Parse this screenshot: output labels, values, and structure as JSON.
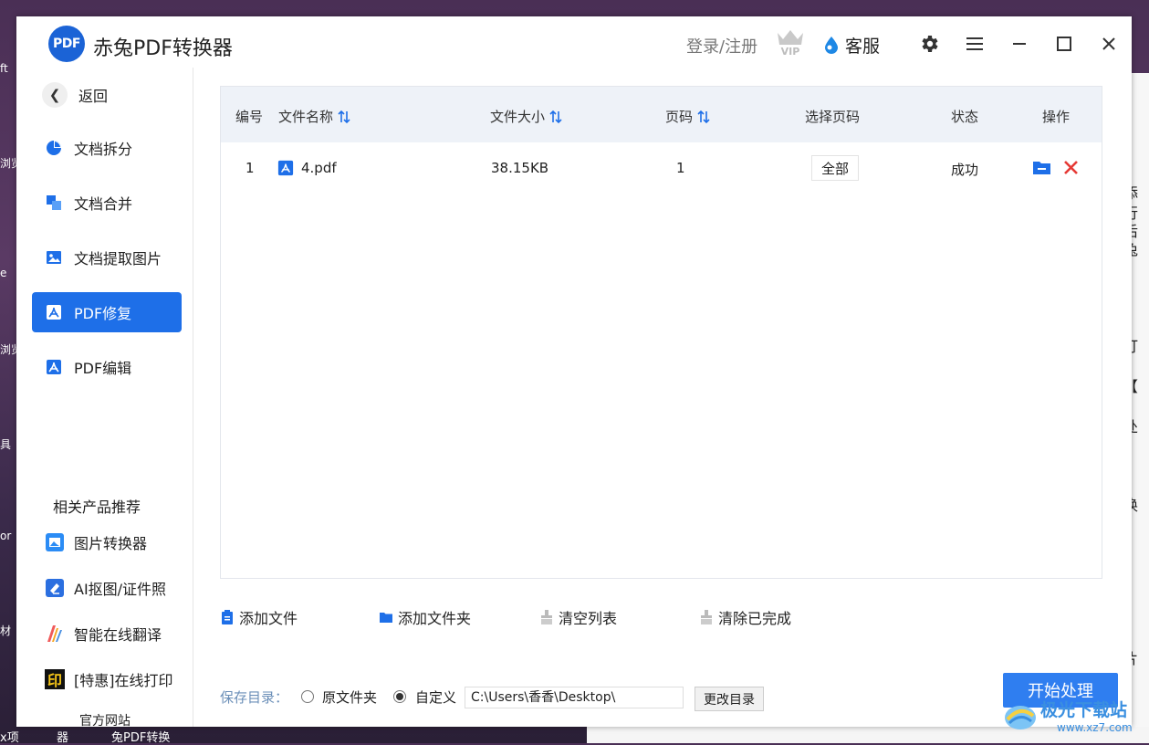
{
  "app": {
    "logo_text": "PDF",
    "title": "赤兔PDF转换器"
  },
  "header": {
    "login": "登录/注册",
    "service": "客服",
    "vip_text": "VIP"
  },
  "sidebar": {
    "back": "返回",
    "items": [
      {
        "label": "文档拆分"
      },
      {
        "label": "文档合并"
      },
      {
        "label": "文档提取图片"
      },
      {
        "label": "PDF修复"
      },
      {
        "label": "PDF编辑"
      }
    ],
    "active_index": 3,
    "recommend_title": "相关产品推荐",
    "recommend": [
      {
        "label": "图片转换器"
      },
      {
        "label": "AI抠图/证件照"
      },
      {
        "label": "智能在线翻译"
      },
      {
        "label": "[特惠]在线打印",
        "icon_text": "印"
      }
    ],
    "official_site": "官方网站"
  },
  "table": {
    "headers": [
      "编号",
      "文件名称",
      "文件大小",
      "页码",
      "选择页码",
      "状态",
      "操作"
    ],
    "rows": [
      {
        "index": "1",
        "name": "4.pdf",
        "size": "38.15KB",
        "pages": "1",
        "page_select": "全部",
        "status": "成功"
      }
    ]
  },
  "actions": {
    "add_file": "添加文件",
    "add_folder": "添加文件夹",
    "clear_list": "清空列表",
    "clear_done": "清除已完成"
  },
  "save": {
    "label": "保存目录：",
    "option_original": "原文件夹",
    "option_custom": "自定义",
    "selected": "自定义",
    "path": "C:\\Users\\香香\\Desktop\\",
    "change_button": "更改目录"
  },
  "start_button": "开始处理",
  "watermark": {
    "text": "极光下载站",
    "url": "www.xz7.com"
  },
  "background": {
    "left_snippets": [
      "ft",
      "浏览",
      "e",
      "浏览",
      "具",
      "or",
      "材"
    ],
    "right_snippets": [
      "添",
      "行",
      "后",
      "兔",
      "打",
      "【",
      "处",
      "换",
      "片"
    ],
    "bottom_left": [
      "x项",
      "器",
      "兔PDF转换"
    ]
  },
  "colors": {
    "accent": "#1e6fe8",
    "start": "#2f7ef0",
    "danger": "#e53935",
    "header_bg": "#eef2f8"
  }
}
